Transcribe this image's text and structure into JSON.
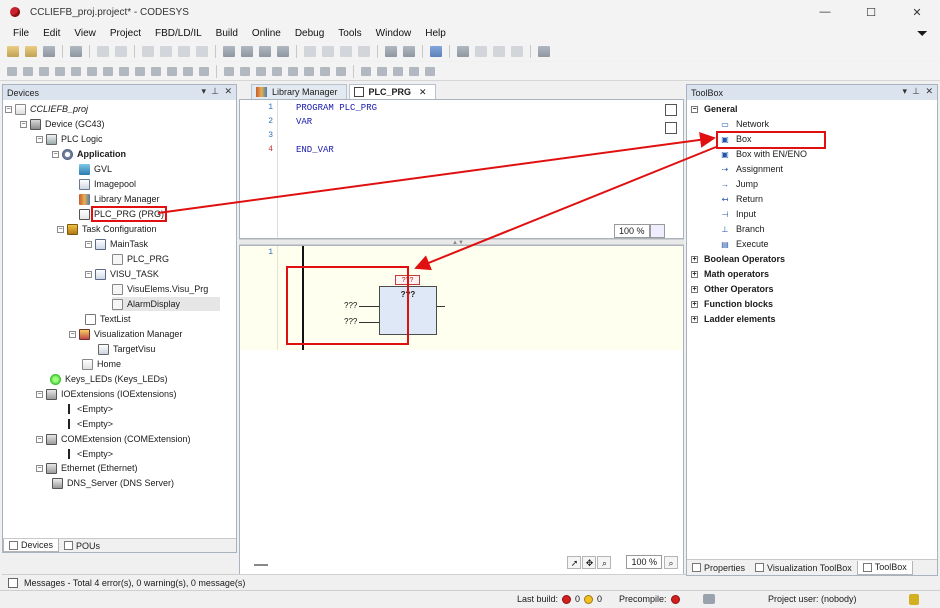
{
  "window": {
    "title": "CCLIEFB_proj.project* - CODESYS",
    "minimize": "—",
    "maximize": "☐",
    "close": "✕"
  },
  "menu": [
    "File",
    "Edit",
    "View",
    "Project",
    "FBD/LD/IL",
    "Build",
    "Online",
    "Debug",
    "Tools",
    "Window",
    "Help"
  ],
  "devices": {
    "title": "Devices",
    "tree": [
      {
        "label": "CCLIEFB_proj"
      },
      {
        "label": "Device (GC43)"
      },
      {
        "label": "PLC Logic"
      },
      {
        "label": "Application"
      },
      {
        "label": "GVL"
      },
      {
        "label": "Imagepool"
      },
      {
        "label": "Library Manager"
      },
      {
        "label": "PLC_PRG (PRG)"
      },
      {
        "label": "Task Configuration"
      },
      {
        "label": "MainTask"
      },
      {
        "label": "PLC_PRG"
      },
      {
        "label": "VISU_TASK"
      },
      {
        "label": "VisuElems.Visu_Prg"
      },
      {
        "label": "AlarmDisplay"
      },
      {
        "label": "TextList"
      },
      {
        "label": "Visualization Manager"
      },
      {
        "label": "TargetVisu"
      },
      {
        "label": "Home"
      },
      {
        "label": "Keys_LEDs (Keys_LEDs)"
      },
      {
        "label": "IOExtensions (IOExtensions)"
      },
      {
        "label": "<Empty>"
      },
      {
        "label": "<Empty>"
      },
      {
        "label": "COMExtension (COMExtension)"
      },
      {
        "label": "<Empty>"
      },
      {
        "label": "Ethernet (Ethernet)"
      },
      {
        "label": "DNS_Server (DNS Server)"
      }
    ],
    "tabs": [
      "Devices",
      "POUs"
    ]
  },
  "editor": {
    "tabs": [
      "Library Manager",
      "PLC_PRG"
    ],
    "close_glyph": "✕",
    "line_numbers": [
      "1",
      "2",
      "3",
      "4"
    ],
    "code": [
      "PROGRAM PLC_PRG",
      "VAR",
      "",
      "END_VAR"
    ],
    "decl_zoom": "100 %",
    "network_number": "1",
    "box": {
      "instance": "???",
      "name": "???",
      "in1": "???",
      "in2": "???"
    },
    "body_zoom": "100 %"
  },
  "toolbox": {
    "title": "ToolBox",
    "groups": [
      {
        "label": "General",
        "expanded": true
      },
      {
        "label": "Boolean Operators"
      },
      {
        "label": "Math operators"
      },
      {
        "label": "Other Operators"
      },
      {
        "label": "Function blocks"
      },
      {
        "label": "Ladder elements"
      }
    ],
    "items": [
      {
        "label": "Network",
        "icon": "network-icon"
      },
      {
        "label": "Box",
        "icon": "box-icon"
      },
      {
        "label": "Box with EN/ENO",
        "icon": "box-en-icon"
      },
      {
        "label": "Assignment",
        "icon": "assignment-icon"
      },
      {
        "label": "Jump",
        "icon": "jump-icon"
      },
      {
        "label": "Return",
        "icon": "return-icon"
      },
      {
        "label": "Input",
        "icon": "input-icon"
      },
      {
        "label": "Branch",
        "icon": "branch-icon"
      },
      {
        "label": "Execute",
        "icon": "execute-icon"
      }
    ],
    "tabs": [
      "Properties",
      "Visualization ToolBox",
      "ToolBox"
    ]
  },
  "messages": "Messages - Total 4 error(s), 0 warning(s), 0 message(s)",
  "status": {
    "last_build_label": "Last build:",
    "errors": "0",
    "warnings": "0",
    "precompile_label": "Precompile:",
    "project_user": "Project user: (nobody)"
  },
  "colors": {
    "highlight": "#e01010",
    "panel_header": "#dbe3ee",
    "fbd_box": "#dfe8f6"
  }
}
